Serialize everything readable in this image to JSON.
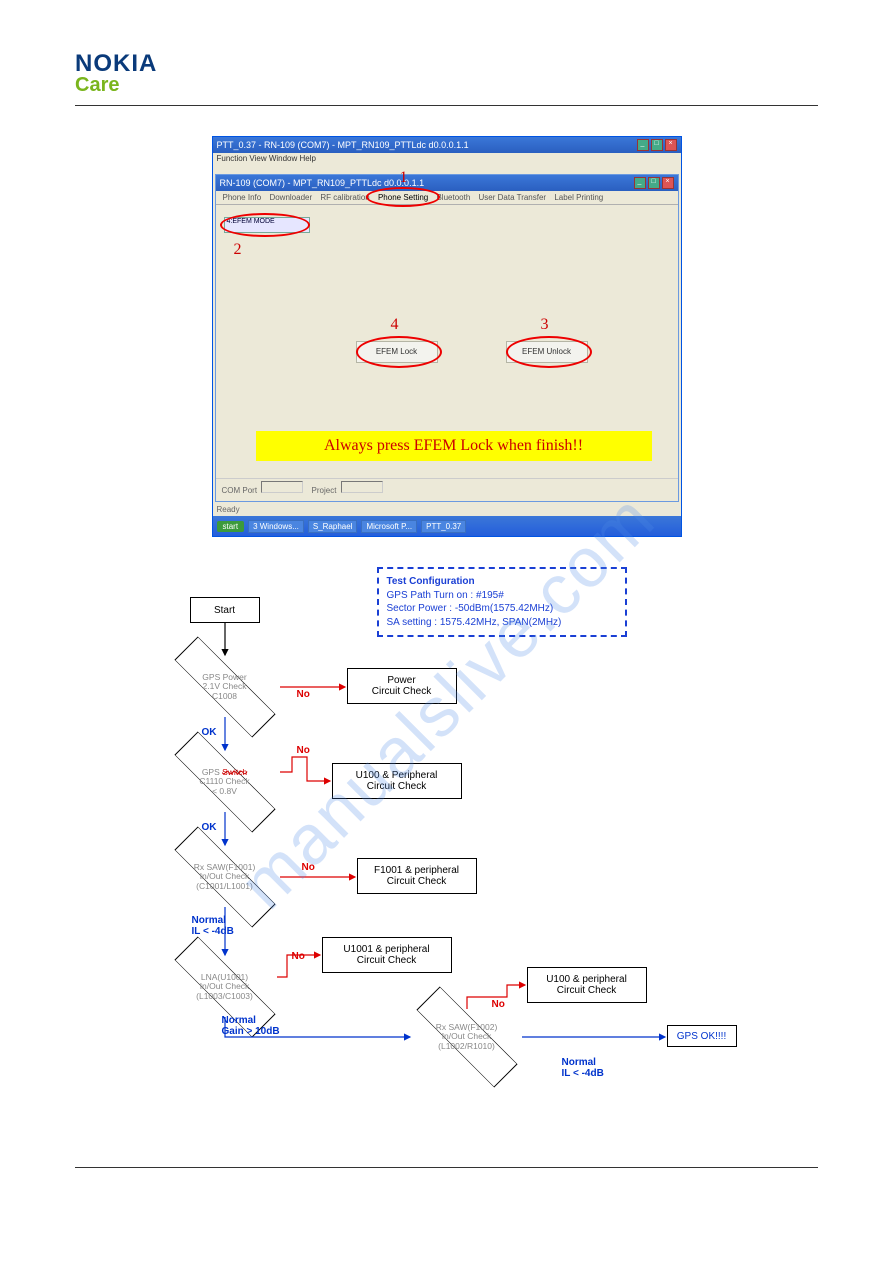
{
  "logo": {
    "brand": "NOKIA",
    "sub": "Care"
  },
  "watermark": "manualslive.com",
  "screenshot": {
    "outer_title": "PTT_0.37 - RN-109 (COM7) - MPT_RN109_PTTLdc d0.0.0.1.1",
    "menu": "Function  View  Window  Help",
    "inner_title": "RN-109 (COM7) - MPT_RN109_PTTLdc d0.0.0.1.1",
    "tabs": {
      "t1": "Phone Info",
      "t2": "Downloader",
      "t3": "RF calibration",
      "t4": "Phone Setting",
      "t5": "Bluetooth",
      "t6": "User Data Transfer",
      "t7": "Label Printing"
    },
    "dropdown": "4:EFEM MODE",
    "btn_lock": "EFEM Lock",
    "btn_unlock": "EFEM Unlock",
    "banner": "Always press EFEM Lock when finish!!",
    "status_com": "COM Port",
    "status_proj": "Project",
    "num1": "1",
    "num2": "2",
    "num3": "3",
    "num4": "4",
    "start_btn": "start"
  },
  "testconfig": {
    "title": "Test Configuration",
    "l1": "GPS Path Turn on : #195#",
    "l2": "Sector Power : -50dBm(1575.42MHz)",
    "l3": "SA setting : 1575.42MHz, SPAN(2MHz)"
  },
  "flow": {
    "start": "Start",
    "d1_l1": "GPS Power",
    "d1_l2": "2.1V Check",
    "d1_l3": "C1008",
    "r1_l1": "Power",
    "r1_l2": "Circuit Check",
    "d2_l1": "GPS ",
    "d2_switch": "Switch",
    "d2_l2": "C1110 Check",
    "d2_l3": "< 0.8V",
    "r2_l1": "U100 & Peripheral",
    "r2_l2": "Circuit Check",
    "d3_l1": "Rx SAW(F1001)",
    "d3_l2": "In/Out Check",
    "d3_l3": "(C1001/L1001)",
    "r3_l1": "F1001 & peripheral",
    "r3_l2": "Circuit Check",
    "d4_l1": "LNA(U1001)",
    "d4_l2": "In/Out Check",
    "d4_l3": "(L1003/C1003)",
    "r4_l1": "U1001 & peripheral",
    "r4_l2": "Circuit Check",
    "d5_l1": "Rx SAW(F1002)",
    "d5_l2": "In/Out Check",
    "d5_l3": "(L1002/R1010)",
    "r5_l1": "U100 & peripheral",
    "r5_l2": "Circuit Check",
    "final": "GPS OK!!!!",
    "no": "No",
    "ok": "OK",
    "norm1": "Normal",
    "il": "IL < -4dB",
    "gain": "Gain > 10dB"
  }
}
